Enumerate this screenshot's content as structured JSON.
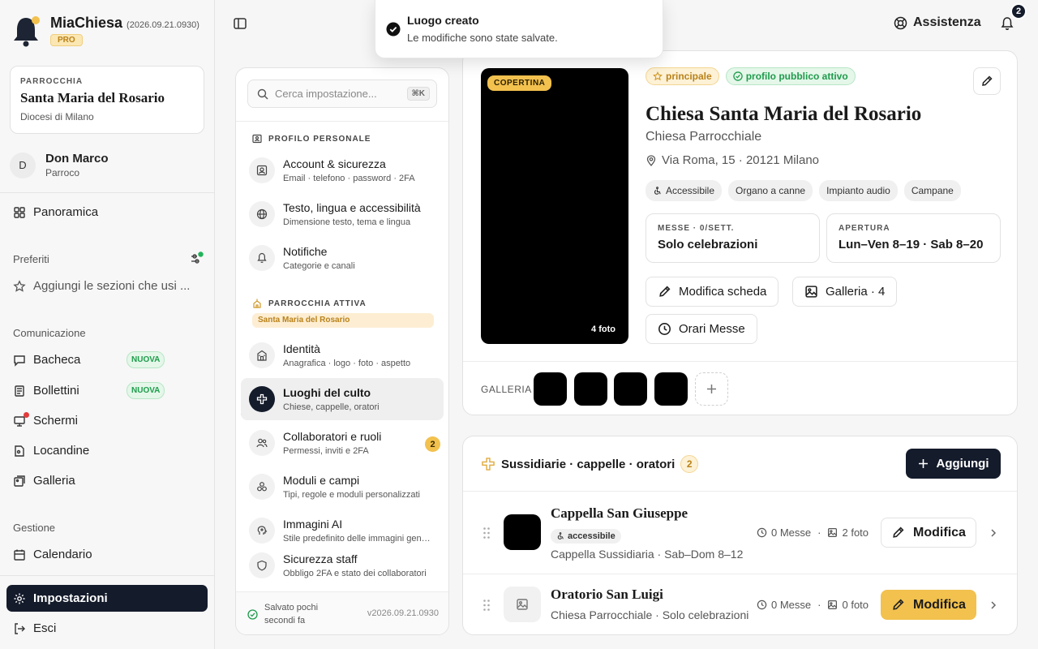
{
  "app": {
    "name": "MiaChiesa",
    "version": "(2026.09.21.0930)",
    "plan": "PRO"
  },
  "parish": {
    "label": "PARROCCHIA",
    "name": "Santa Maria del Rosario",
    "diocese": "Diocesi di Milano"
  },
  "user": {
    "initial": "D",
    "name": "Don Marco",
    "role": "Parroco"
  },
  "nav": {
    "overview": "Panoramica",
    "favorites_title": "Preferiti",
    "favorites_hint": "Aggiungi le sezioni che usi ...",
    "comm_title": "Comunicazione",
    "board": "Bacheca",
    "bulletins": "Bollettini",
    "screens": "Schermi",
    "posters": "Locandine",
    "gallery": "Galleria",
    "new_badge": "NUOVA",
    "manage_title": "Gestione",
    "calendar": "Calendario",
    "settings": "Impostazioni",
    "logout": "Esci"
  },
  "topbar": {
    "help": "Assistenza",
    "notifications": "2"
  },
  "toast": {
    "title": "Luogo creato",
    "message": "Le modifiche sono state salvate."
  },
  "settings": {
    "search_placeholder": "Cerca impostazione...",
    "search_shortcut": "⌘K",
    "section_personal": "PROFILO PERSONALE",
    "section_parish": "PARROCCHIA ATTIVA",
    "active_parish": "Santa Maria del Rosario",
    "items": [
      {
        "title": "Account & sicurezza",
        "sub": "Email · telefono · password · 2FA"
      },
      {
        "title": "Testo, lingua e accessibilità",
        "sub": "Dimensione testo, tema e lingua"
      },
      {
        "title": "Notifiche",
        "sub": "Categorie e canali"
      },
      {
        "title": "Identità",
        "sub": "Anagrafica · logo · foto · aspetto"
      },
      {
        "title": "Luoghi del culto",
        "sub": "Chiese, cappelle, oratori"
      },
      {
        "title": "Collaboratori e ruoli",
        "sub": "Permessi, inviti e 2FA",
        "badge": "2"
      },
      {
        "title": "Moduli e campi",
        "sub": "Tipi, regole e moduli personalizzati"
      },
      {
        "title": "Immagini AI",
        "sub": "Stile predefinito delle immagini generate"
      },
      {
        "title": "Sicurezza staff",
        "sub": "Obbligo 2FA e stato dei collaboratori"
      }
    ],
    "saved": "Salvato pochi secondi fa",
    "footer_version": "v2026.09.21.0930"
  },
  "church": {
    "cover_tag": "COPERTINA",
    "photo_count": "4 foto",
    "tag_main": "principale",
    "tag_public": "profilo pubblico attivo",
    "title": "Chiesa Santa Maria del Rosario",
    "type": "Chiesa Parrocchiale",
    "address": "Via Roma, 15 · 20121 Milano",
    "features": [
      "Accessibile",
      "Organo a canne",
      "Impianto audio",
      "Campane"
    ],
    "masses_label": "MESSE · 0/SETT.",
    "masses_value": "Solo celebrazioni",
    "opening_label": "APERTURA",
    "opening_value": "Lun–Ven 8–19 · Sab 8–20",
    "edit_btn": "Modifica scheda",
    "gallery_btn": "Galleria · 4",
    "masses_btn": "Orari Messe",
    "gallery_label": "GALLERIA"
  },
  "subsidiaries": {
    "title": "Sussidiarie · cappelle · oratori",
    "count": "2",
    "add_btn": "Aggiungi",
    "rows": [
      {
        "name": "Cappella San Giuseppe",
        "chip": "accessibile",
        "desc": "Cappella Sussidiaria · Sab–Dom 8–12",
        "masses": "0 Messe",
        "photos": "2 foto",
        "btn": "Modifica"
      },
      {
        "name": "Oratorio San Luigi",
        "desc": "Chiesa Parrocchiale · Solo celebrazioni",
        "masses": "0 Messe",
        "photos": "0 foto",
        "btn": "Modifica"
      }
    ]
  },
  "colors": {
    "accent_gold": "#f2c14e",
    "dark": "#141b2b",
    "success": "#1f9b4c",
    "alert": "#e33b3b"
  }
}
